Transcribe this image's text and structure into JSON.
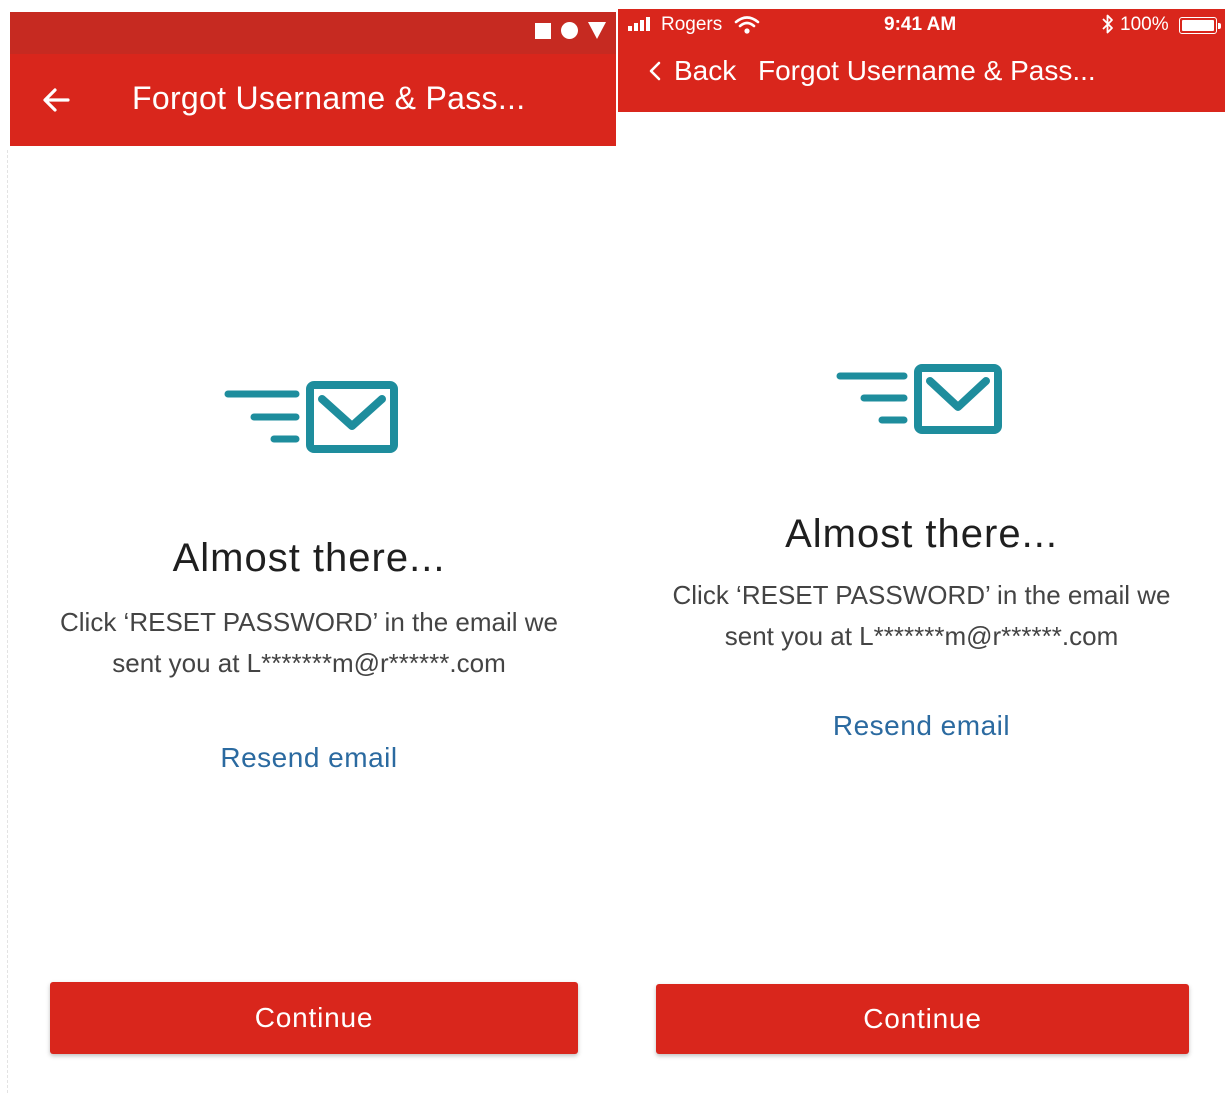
{
  "colors": {
    "brand_red": "#d9261c",
    "status_bar_red": "#c62a21",
    "icon_teal": "#1e8d9d",
    "link_blue": "#2b6aa0",
    "heading_text": "#1f1f1f",
    "body_text": "#444444"
  },
  "android": {
    "status_icons": [
      "square-icon",
      "circle-icon",
      "triangle-icon"
    ],
    "appbar": {
      "back_icon": "arrow-left-icon",
      "title": "Forgot Username & Pass..."
    },
    "content": {
      "icon": "email-sent-icon",
      "heading": "Almost there...",
      "body_line1": "Click ‘RESET PASSWORD’ in the email we",
      "body_line2": "sent you at L*******m@r******.com",
      "resend_label": "Resend email"
    },
    "continue_label": "Continue"
  },
  "ios": {
    "status": {
      "carrier": "Rogers",
      "time": "9:41 AM",
      "bluetooth_icon": "bluetooth-icon",
      "battery": "100%"
    },
    "nav": {
      "back_label": "Back",
      "title": "Forgot Username & Pass..."
    },
    "content": {
      "icon": "email-sent-icon",
      "heading": "Almost there...",
      "body_line1": "Click ‘RESET PASSWORD’ in the email we",
      "body_line2": "sent you at L*******m@r******.com",
      "resend_label": "Resend email"
    },
    "continue_label": "Continue"
  }
}
